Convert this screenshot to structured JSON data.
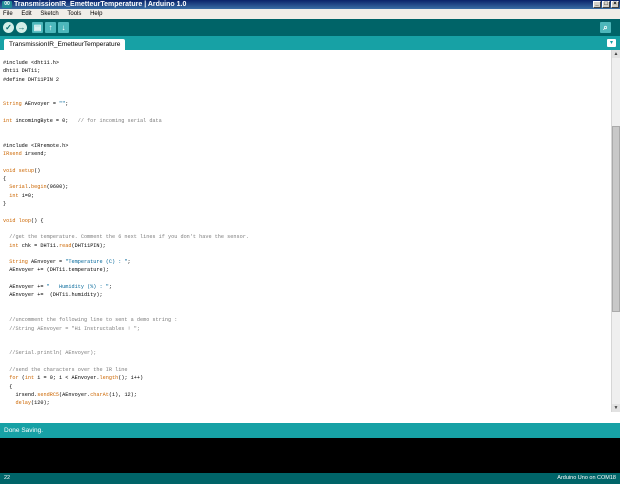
{
  "window": {
    "title": "TransmissionIR_EmetteurTemperature | Arduino 1.0",
    "app_icon": "00"
  },
  "menu": {
    "items": [
      "File",
      "Edit",
      "Sketch",
      "Tools",
      "Help"
    ]
  },
  "toolbar": {
    "verify_icon": "✓",
    "upload_icon": "→",
    "new_icon": "▤",
    "open_icon": "↑",
    "save_icon": "↓",
    "serial_icon": "⌕"
  },
  "tab": {
    "name": "TransmissionIR_EmetteurTemperature",
    "menu_icon": "▾"
  },
  "code": [
    "#include <dht11.h>",
    "dht11 DHT11;",
    "#define DHT11PIN 2",
    "",
    "",
    "String AEnvoyer = \"\";",
    "",
    "int incomingByte = 0;   // for incoming serial data",
    "",
    "",
    "#include <IRremote.h>",
    "IRsend irsend;",
    "",
    "void setup()",
    "{",
    "  Serial.begin(9600);",
    "  int i=0;",
    "}",
    "",
    "void loop() {",
    "",
    "  //get the temperature. Comment the 6 next lines if you don't have the sensor.",
    "  int chk = DHT11.read(DHT11PIN);",
    "",
    "  String AEnvoyer = \"Temperature (C) : \";",
    "  AEnvoyer += (DHT11.temperature);",
    "",
    "  AEnvoyer += \"   Humidity (%) : \";",
    "  AEnvoyer +=  (DHT11.humidity);",
    "",
    "",
    "  //uncomment the following line to sent a demo string :",
    "  //String AEnvoyer = \"Hi Instructables ! \";",
    "",
    "",
    "  //Serial.println( AEnvoyer);",
    "",
    "  //send the characters over the IR line",
    "  for (int i = 0; i < AEnvoyer.length(); i++)",
    "  {",
    "    irsend.sendRC5(AEnvoyer.charAt(i), 12);",
    "    delay(120);"
  ],
  "status": {
    "message": "Done Saving."
  },
  "footer": {
    "line_number": "22",
    "board": "Arduino Uno on COM18"
  },
  "colors": {
    "teal": "#17a1a5",
    "dark_teal": "#006468",
    "keyword": "#cc6600",
    "comment": "#7e7e7e",
    "string": "#006699"
  }
}
